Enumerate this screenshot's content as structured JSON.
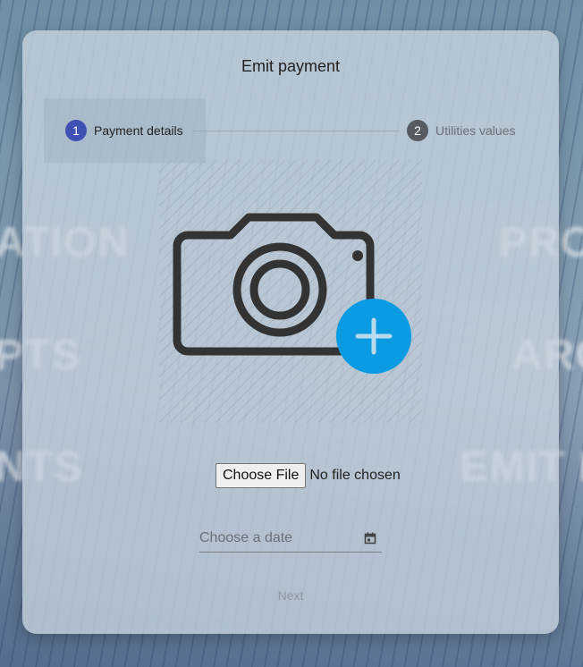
{
  "background_words": [
    "ATION",
    "PTS",
    "NTS",
    "PRO",
    "ARC",
    "EMIT I"
  ],
  "dialog": {
    "title": "Emit payment"
  },
  "stepper": {
    "steps": [
      {
        "number": "1",
        "label": "Payment details",
        "state": "active"
      },
      {
        "number": "2",
        "label": "Utilities values",
        "state": "inactive"
      }
    ]
  },
  "upload": {
    "icon": "camera-icon",
    "add_icon": "plus-circle-icon",
    "accent_color": "#0b9be3"
  },
  "file_input": {
    "button_label": "Choose File",
    "status": "No file chosen"
  },
  "date_input": {
    "placeholder": "Choose a date",
    "icon": "calendar-icon"
  },
  "actions": {
    "next_label": "Next"
  },
  "colors": {
    "active_step": "#3f51b5",
    "inactive_step": "#555b61"
  }
}
